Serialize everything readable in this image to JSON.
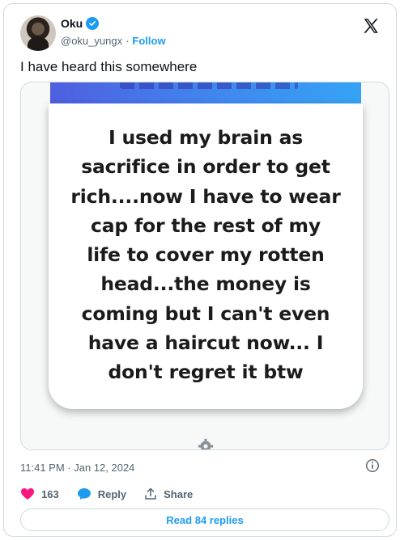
{
  "author": {
    "name": "Oku",
    "handle": "@oku_yungx",
    "separator": "·",
    "follow_label": "Follow"
  },
  "tweet": {
    "text": "I have heard this somewhere",
    "image_quote_lines": [
      "I used my brain as",
      "sacrifice in order to get",
      "rich....now I have to wear",
      "cap for the rest of my",
      "life to cover my rotten",
      "head...the money is",
      "coming but I can't even",
      "have a haircut now... I",
      "don't regret it btw"
    ],
    "timestamp": "11:41 PM · Jan 12, 2024"
  },
  "actions": {
    "like_count": "163",
    "reply_label": "Reply",
    "share_label": "Share"
  },
  "read_replies_label": "Read 84 replies",
  "colors": {
    "accent": "#1d9bf0",
    "like": "#f91880",
    "muted": "#536471",
    "border": "#cfd9de"
  },
  "icons": [
    "verified-badge-icon",
    "x-logo-icon",
    "settings-gear-icon",
    "info-icon",
    "heart-icon",
    "reply-bubble-icon",
    "share-icon"
  ]
}
